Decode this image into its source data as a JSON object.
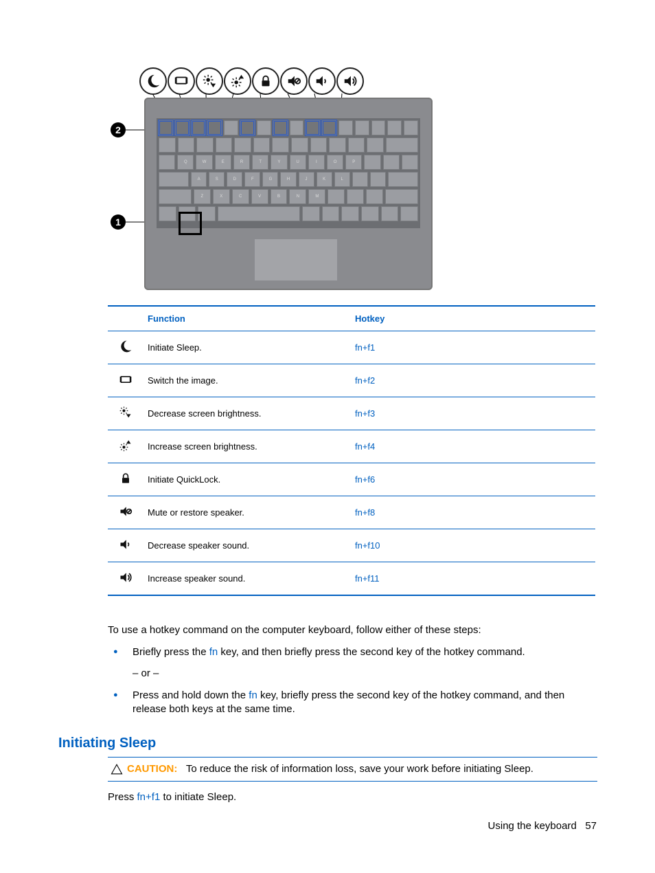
{
  "table": {
    "headers": {
      "function": "Function",
      "hotkey": "Hotkey"
    },
    "rows": [
      {
        "icon": "sleep",
        "function": "Initiate Sleep.",
        "hotkey": "fn+f1"
      },
      {
        "icon": "switch",
        "function": "Switch the image.",
        "hotkey": "fn+f2"
      },
      {
        "icon": "bright-down",
        "function": "Decrease screen brightness.",
        "hotkey": "fn+f3"
      },
      {
        "icon": "bright-up",
        "function": "Increase screen brightness.",
        "hotkey": "fn+f4"
      },
      {
        "icon": "lock",
        "function": "Initiate QuickLock.",
        "hotkey": "fn+f6"
      },
      {
        "icon": "mute",
        "function": "Mute or restore speaker.",
        "hotkey": "fn+f8"
      },
      {
        "icon": "vol-down",
        "function": "Decrease speaker sound.",
        "hotkey": "fn+f10"
      },
      {
        "icon": "vol-up",
        "function": "Increase speaker sound.",
        "hotkey": "fn+f11"
      }
    ]
  },
  "prose": {
    "intro": "To use a hotkey command on the computer keyboard, follow either of these steps:",
    "bullet1_a": "Briefly press the ",
    "bullet1_key": "fn",
    "bullet1_b": " key, and then briefly press the second key of the hotkey command.",
    "or": "– or –",
    "bullet2_a": "Press and hold down the ",
    "bullet2_key": "fn",
    "bullet2_b": " key, briefly press the second key of the hotkey command, and then release both keys at the same time."
  },
  "section_heading": "Initiating Sleep",
  "caution": {
    "label": "CAUTION:",
    "text": "To reduce the risk of information loss, save your work before initiating Sleep."
  },
  "after_caution_a": "Press ",
  "after_caution_key": "fn+f1",
  "after_caution_b": " to initiate Sleep.",
  "footer": {
    "section": "Using the keyboard",
    "page": "57"
  },
  "diagram": {
    "callouts": {
      "1": "1",
      "2": "2"
    },
    "icon_order": [
      "sleep",
      "switch",
      "bright-down",
      "bright-up",
      "lock",
      "mute",
      "vol-down",
      "vol-up"
    ]
  }
}
